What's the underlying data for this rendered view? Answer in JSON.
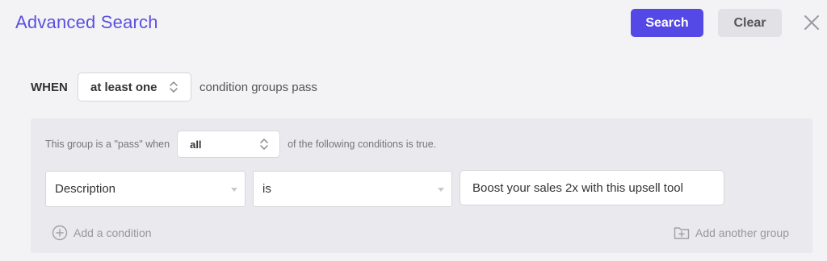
{
  "header": {
    "title": "Advanced Search",
    "search_label": "Search",
    "clear_label": "Clear"
  },
  "when_row": {
    "label": "WHEN",
    "selected": "at least one",
    "suffix": "condition groups pass"
  },
  "group": {
    "prefix": "This group is a \"pass\" when",
    "selected": "all",
    "suffix": "of the following conditions is true.",
    "condition": {
      "field": "Description",
      "operator": "is",
      "value": "Boost your sales 2x with this upsell tool"
    },
    "add_condition_label": "Add a condition",
    "add_group_label": "Add another group"
  },
  "colors": {
    "accent": "#5448e6",
    "title": "#5b4fe0",
    "background": "#f3f3f5",
    "group_background": "#e9e9ee"
  },
  "icons": [
    "close-icon",
    "updown-chevron-icon",
    "chevron-down-icon",
    "plus-circle-icon",
    "folder-plus-icon"
  ]
}
